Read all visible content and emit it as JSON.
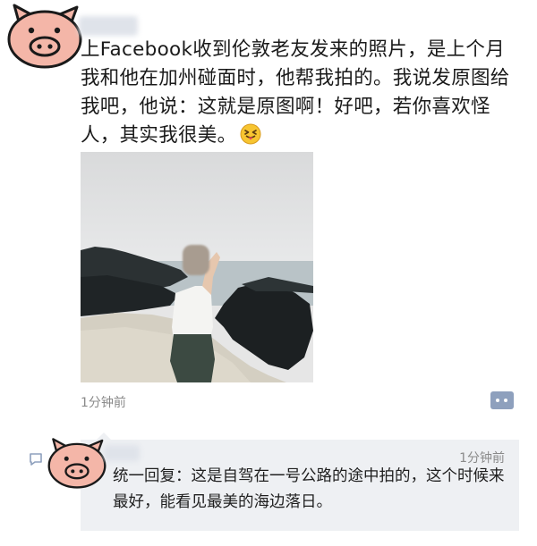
{
  "post": {
    "text": "上Facebook收到伦敦老友发来的照片，是上个月我和他在加州碰面时，他帮我拍的。我说发原图给我吧，他说：这就是原图啊！好吧，若你喜欢怪人，其实我很美。",
    "emoji": "tongue-wink-emoji",
    "time": "1分钟前"
  },
  "comment": {
    "time": "1分钟前",
    "text": "统一回复：这是自驾在一号公路的途中拍的，这个时候来最好，能看见最美的海边落日。"
  },
  "colors": {
    "pig_pink": "#f4b6a8",
    "pig_outline": "#1a1a1a",
    "comment_bg": "#eef0f3",
    "meta_gray": "#8a8a8a",
    "more_button": "#8ea0bd"
  }
}
